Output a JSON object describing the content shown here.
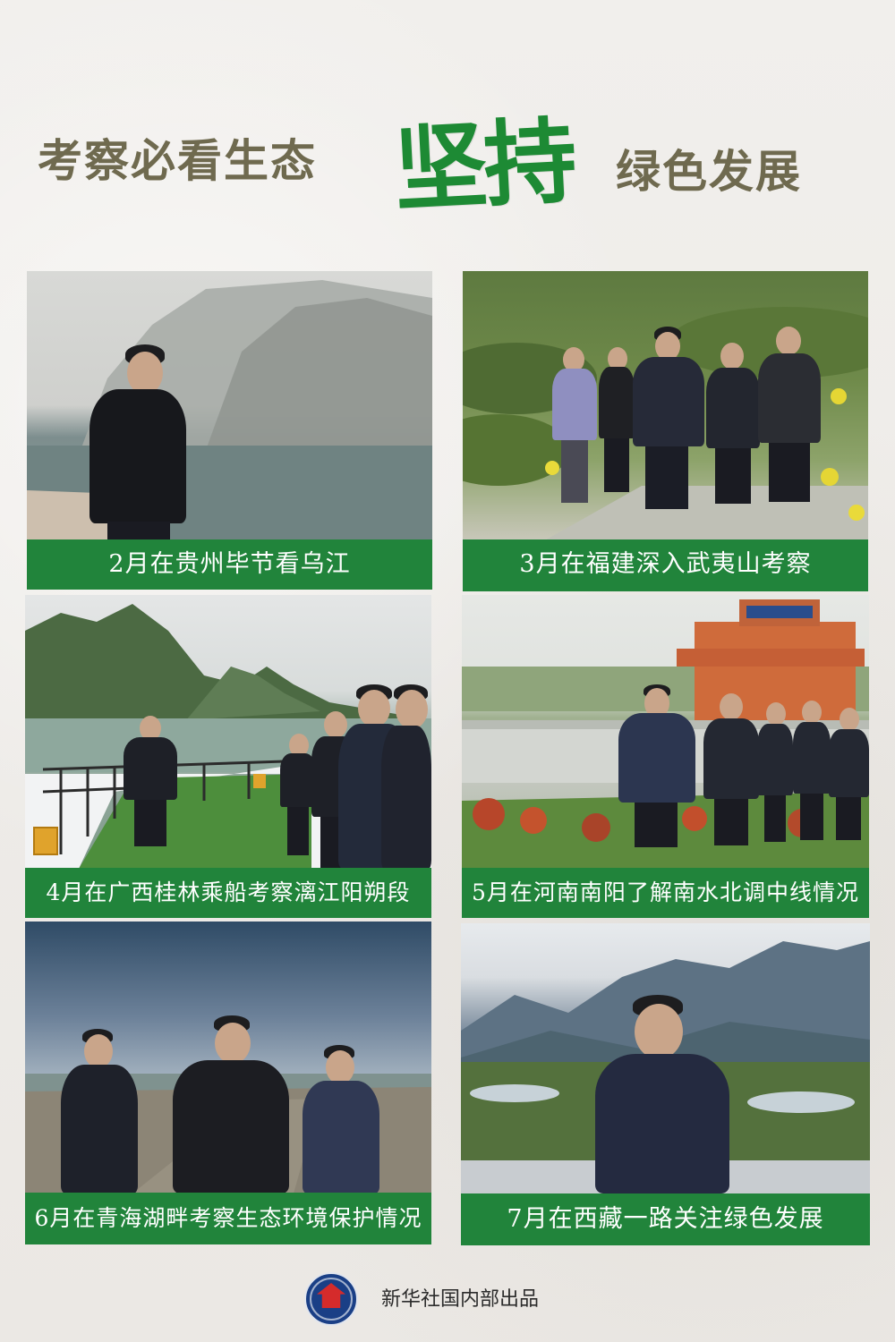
{
  "header": {
    "left_text": "考察必看生态",
    "center_text": "坚持",
    "right_text": "绿色发展"
  },
  "photos": [
    {
      "caption": "2月在贵州毕节看乌江"
    },
    {
      "caption": "3月在福建深入武夷山考察"
    },
    {
      "caption": "4月在广西桂林乘船考察漓江阳朔段"
    },
    {
      "caption": "5月在河南南阳了解南水北调中线情况"
    },
    {
      "caption": "6月在青海湖畔考察生态环境保护情况"
    },
    {
      "caption": "7月在西藏一路关注绿色发展"
    }
  ],
  "footer": {
    "credit": "新华社国内部出品"
  },
  "colors": {
    "caption_green": "#21843b",
    "title_green": "#1d8a34",
    "title_olive": "#6f6a4f",
    "logo_blue": "#1a3f86",
    "logo_red": "#d52b2b"
  }
}
